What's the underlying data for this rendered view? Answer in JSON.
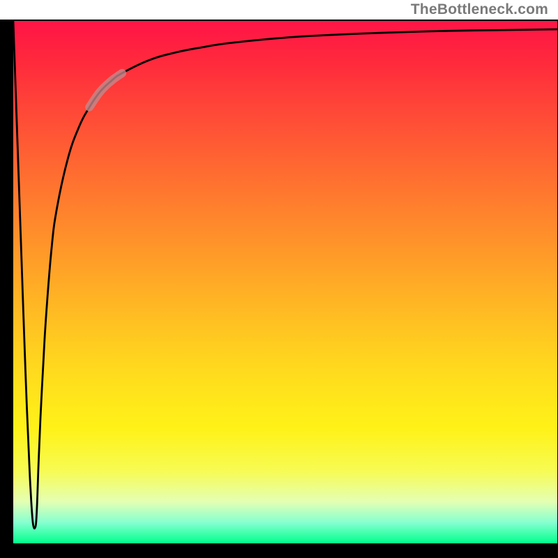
{
  "watermark": "TheBottleneck.com",
  "chart_data": {
    "type": "line",
    "title": "",
    "xlabel": "",
    "ylabel": "",
    "xlim": [
      0,
      100
    ],
    "ylim": [
      0,
      100
    ],
    "grid": false,
    "series": [
      {
        "name": "bottleneck-curve",
        "x": [
          0.0,
          0.5,
          1.0,
          1.5,
          2.0,
          2.5,
          3.0,
          3.2,
          3.4,
          3.6,
          3.8,
          4.0,
          4.2,
          4.4,
          4.6,
          5.0,
          5.5,
          6.0,
          7.0,
          8.0,
          10.0,
          12.0,
          14.0,
          16.0,
          18.0,
          20.0,
          25.0,
          30.0,
          35.0,
          40.0,
          50.0,
          60.0,
          70.0,
          80.0,
          90.0,
          100.0
        ],
        "values": [
          100.0,
          85.0,
          70.0,
          55.0,
          40.0,
          26.0,
          14.0,
          10.0,
          6.5,
          4.0,
          3.0,
          3.0,
          4.0,
          8.0,
          14.0,
          24.0,
          34.0,
          43.0,
          56.0,
          64.0,
          73.5,
          79.5,
          83.5,
          86.5,
          88.5,
          90.0,
          92.5,
          94.0,
          95.0,
          95.8,
          96.8,
          97.4,
          97.8,
          98.1,
          98.25,
          98.4
        ],
        "highlight_range_x": [
          14.0,
          20.0
        ]
      }
    ],
    "gradient_colors": {
      "top": "#ff1446",
      "mid": "#ffd81e",
      "bottom": "#00ff8c"
    }
  }
}
